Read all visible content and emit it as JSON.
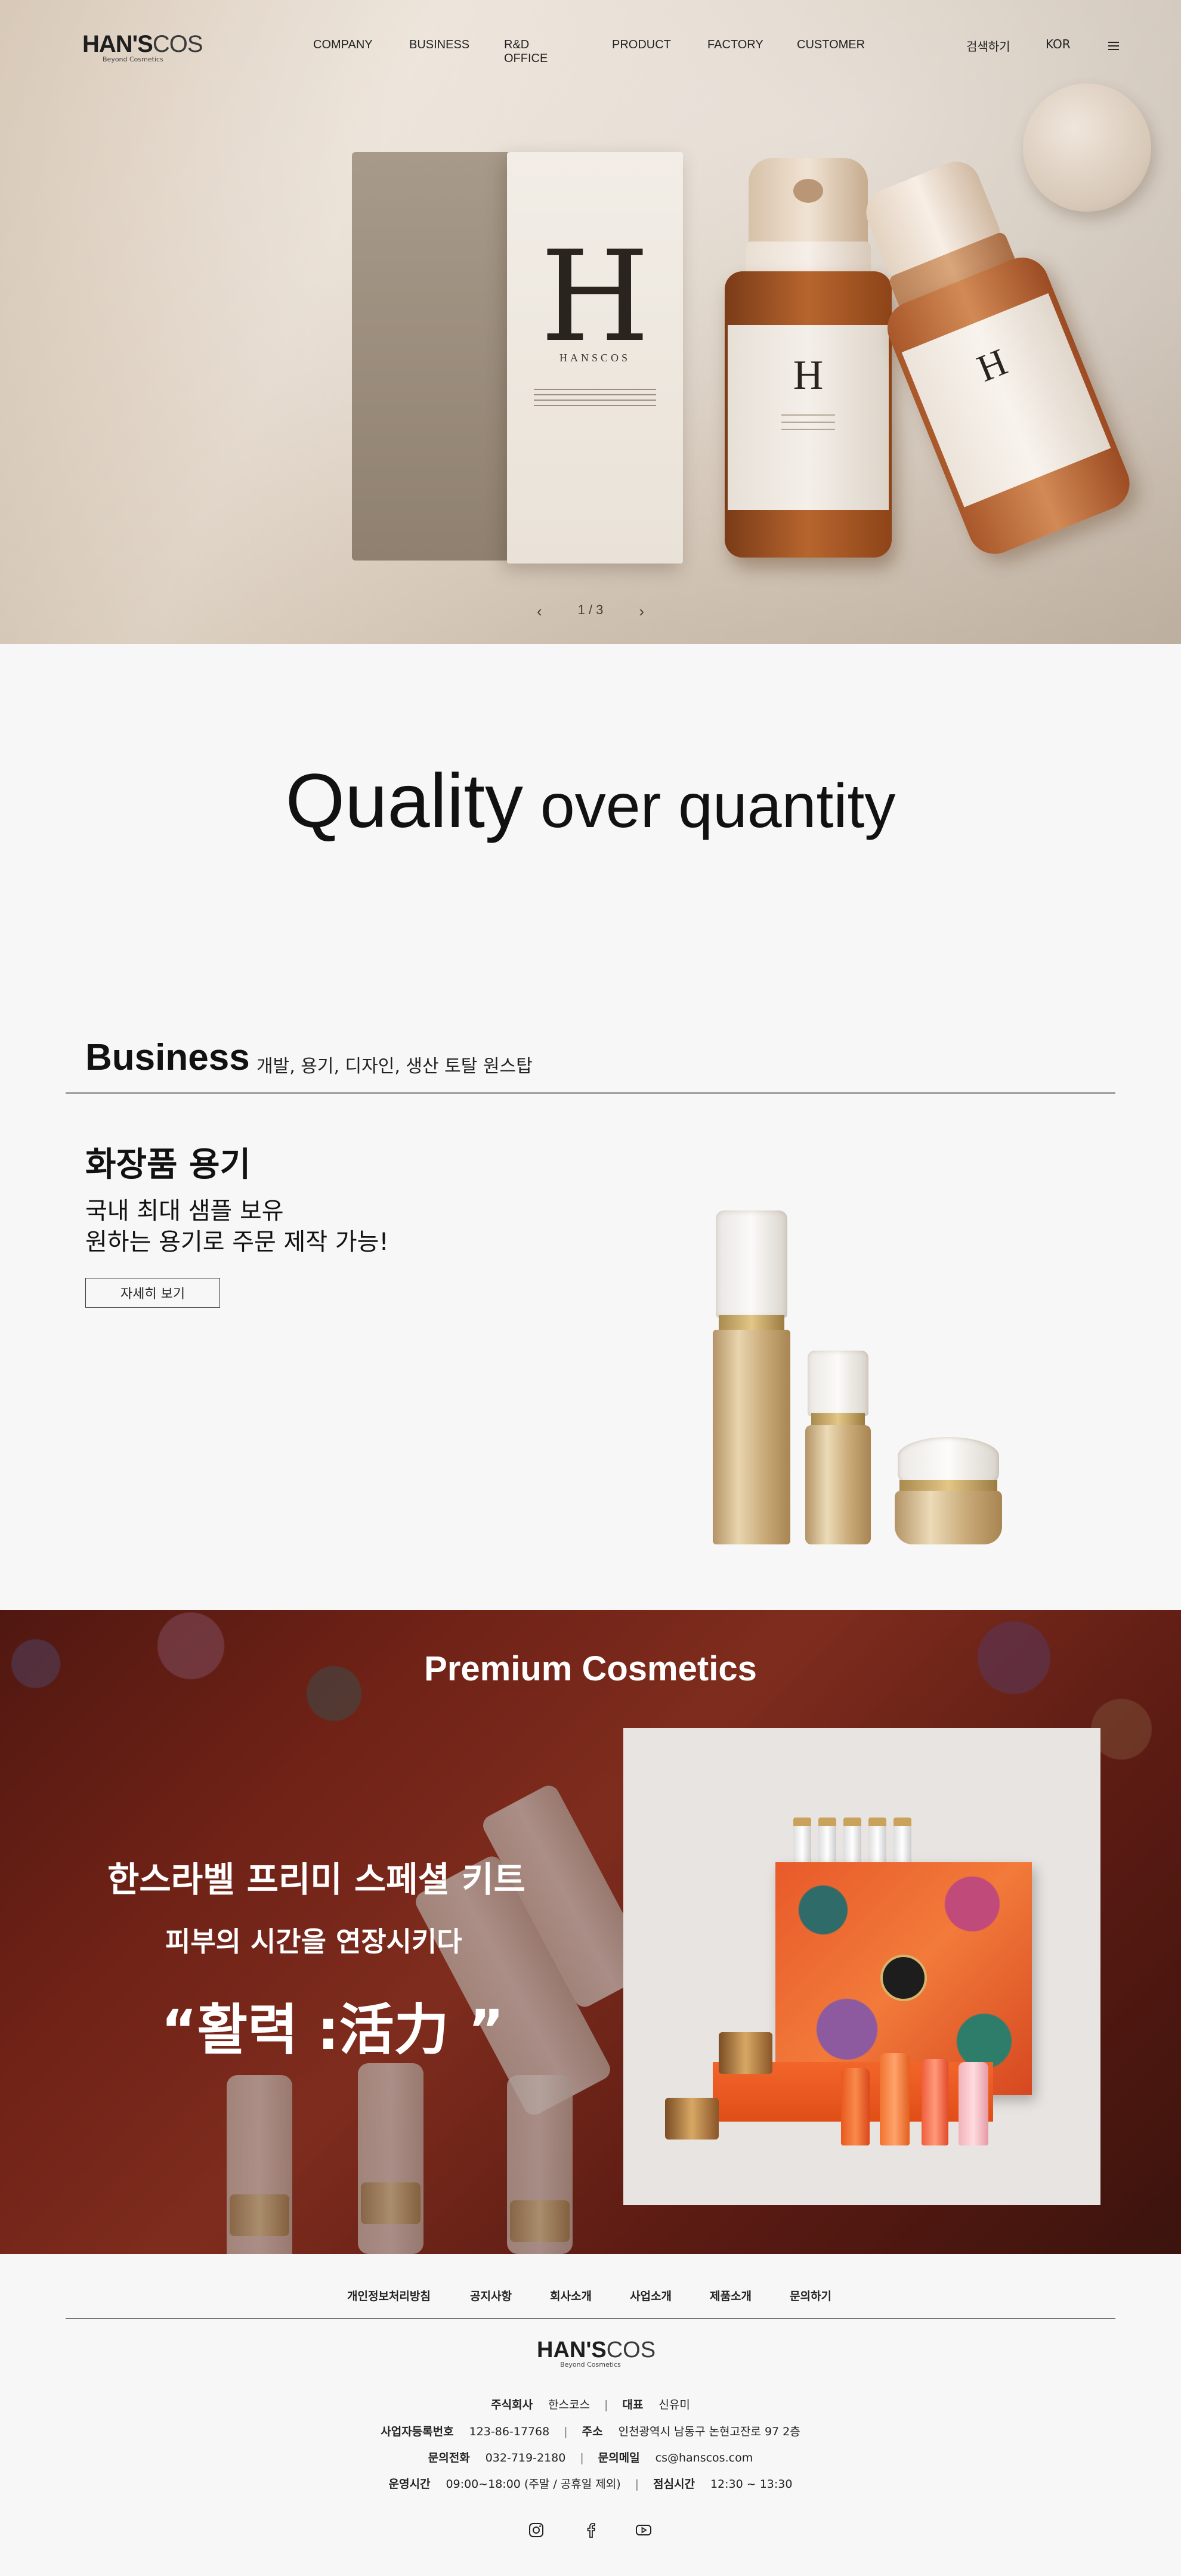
{
  "header": {
    "logo_text_a": "HAN'S",
    "logo_text_b": "COS",
    "logo_sub": "Beyond Cosmetics",
    "nav": [
      "COMPANY",
      "BUSINESS",
      "R&D OFFICE",
      "PRODUCT",
      "FACTORY",
      "CUSTOMER"
    ],
    "search": "검색하기",
    "lang": "KOR"
  },
  "hero": {
    "box_brand": "HANSCOS",
    "box_letter": "H",
    "slide_indicator": "1 / 3"
  },
  "quality": {
    "word1": "Quality",
    "rest": " over quantity"
  },
  "business": {
    "title": "Business",
    "subtitle": "개발, 용기, 디자인, 생산 토탈 원스탑",
    "content_title": "화장품 용기",
    "content_desc_1": "국내 최대 샘플 보유",
    "content_desc_2": "원하는 용기로 주문 제작 가능!",
    "more_button": "자세히 보기"
  },
  "premium": {
    "title": "Premium Cosmetics",
    "kit_title": "한스라벨 프리미 스페셜  키트",
    "subtitle": "피부의 시간을 연장시키다",
    "quote": "“활력 :活力 ”"
  },
  "footer": {
    "links": [
      "개인정보처리방침",
      "공지사항",
      "회사소개",
      "사업소개",
      "제품소개",
      "문의하기"
    ],
    "company_label": "주식회사",
    "company_value": "한스코스",
    "ceo_label": "대표",
    "ceo_value": "신유미",
    "reg_label": "사업자등록번호",
    "reg_value": "123-86-17768",
    "addr_label": "주소",
    "addr_value": "인천광역시 남동구 논현고잔로 97 2층",
    "tel_label": "문의전화",
    "tel_value": "032-719-2180",
    "email_label": "문의메일",
    "email_value": "cs@hanscos.com",
    "hours_label": "운영시간",
    "hours_value": "09:00~18:00 (주말 / 공휴일 제외)",
    "lunch_label": "점심시간",
    "lunch_value": "12:30 ~ 13:30",
    "social": [
      "instagram-icon",
      "facebook-icon",
      "youtube-icon"
    ]
  }
}
